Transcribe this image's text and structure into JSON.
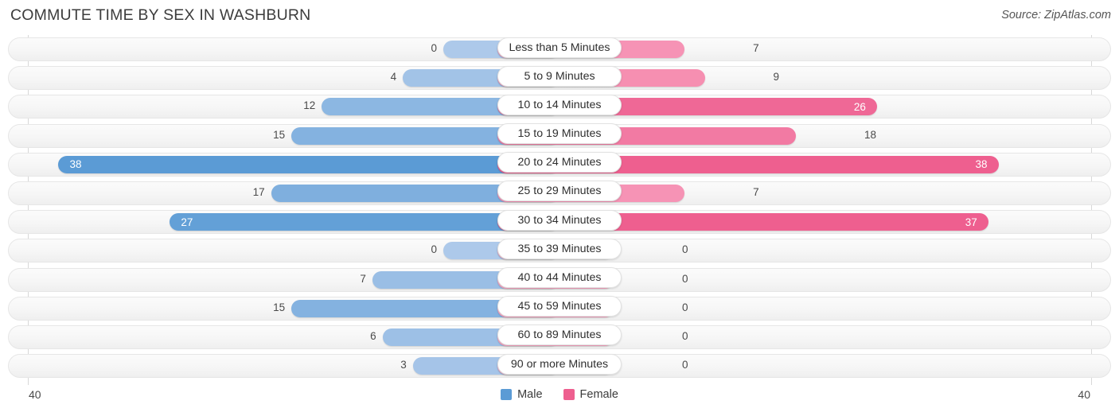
{
  "header": {
    "title": "COMMUTE TIME BY SEX IN WASHBURN",
    "source": "Source: ZipAtlas.com"
  },
  "legend": {
    "male_label": "Male",
    "female_label": "Female",
    "male_color": "#5b9bd5",
    "female_color": "#ee5f8f"
  },
  "axis": {
    "left_tick": "40",
    "right_tick": "40",
    "max": 40
  },
  "colors": {
    "male_light": "#adc9ea",
    "male_strong": "#5b9bd5",
    "female_light": "#f9a3c0",
    "female_strong": "#ee5f8f",
    "track": "#f6f6f6",
    "pill_bg": "#ffffff"
  },
  "chart_data": {
    "type": "bar",
    "title": "COMMUTE TIME BY SEX IN WASHBURN",
    "subtitle": "Source: ZipAtlas.com",
    "orientation": "horizontal-diverging",
    "xlabel": "",
    "ylabel": "",
    "xlim": [
      40,
      40
    ],
    "grid": false,
    "legend_position": "bottom-center",
    "categories": [
      "Less than 5 Minutes",
      "5 to 9 Minutes",
      "10 to 14 Minutes",
      "15 to 19 Minutes",
      "20 to 24 Minutes",
      "25 to 29 Minutes",
      "30 to 34 Minutes",
      "35 to 39 Minutes",
      "40 to 44 Minutes",
      "45 to 59 Minutes",
      "60 to 89 Minutes",
      "90 or more Minutes"
    ],
    "series": [
      {
        "name": "Male",
        "side": "left",
        "color": "#5b9bd5",
        "values": [
          0,
          4,
          12,
          15,
          38,
          17,
          27,
          0,
          7,
          15,
          6,
          3
        ]
      },
      {
        "name": "Female",
        "side": "right",
        "color": "#ee5f8f",
        "values": [
          7,
          9,
          26,
          18,
          38,
          7,
          37,
          0,
          0,
          0,
          0,
          0
        ]
      }
    ]
  }
}
